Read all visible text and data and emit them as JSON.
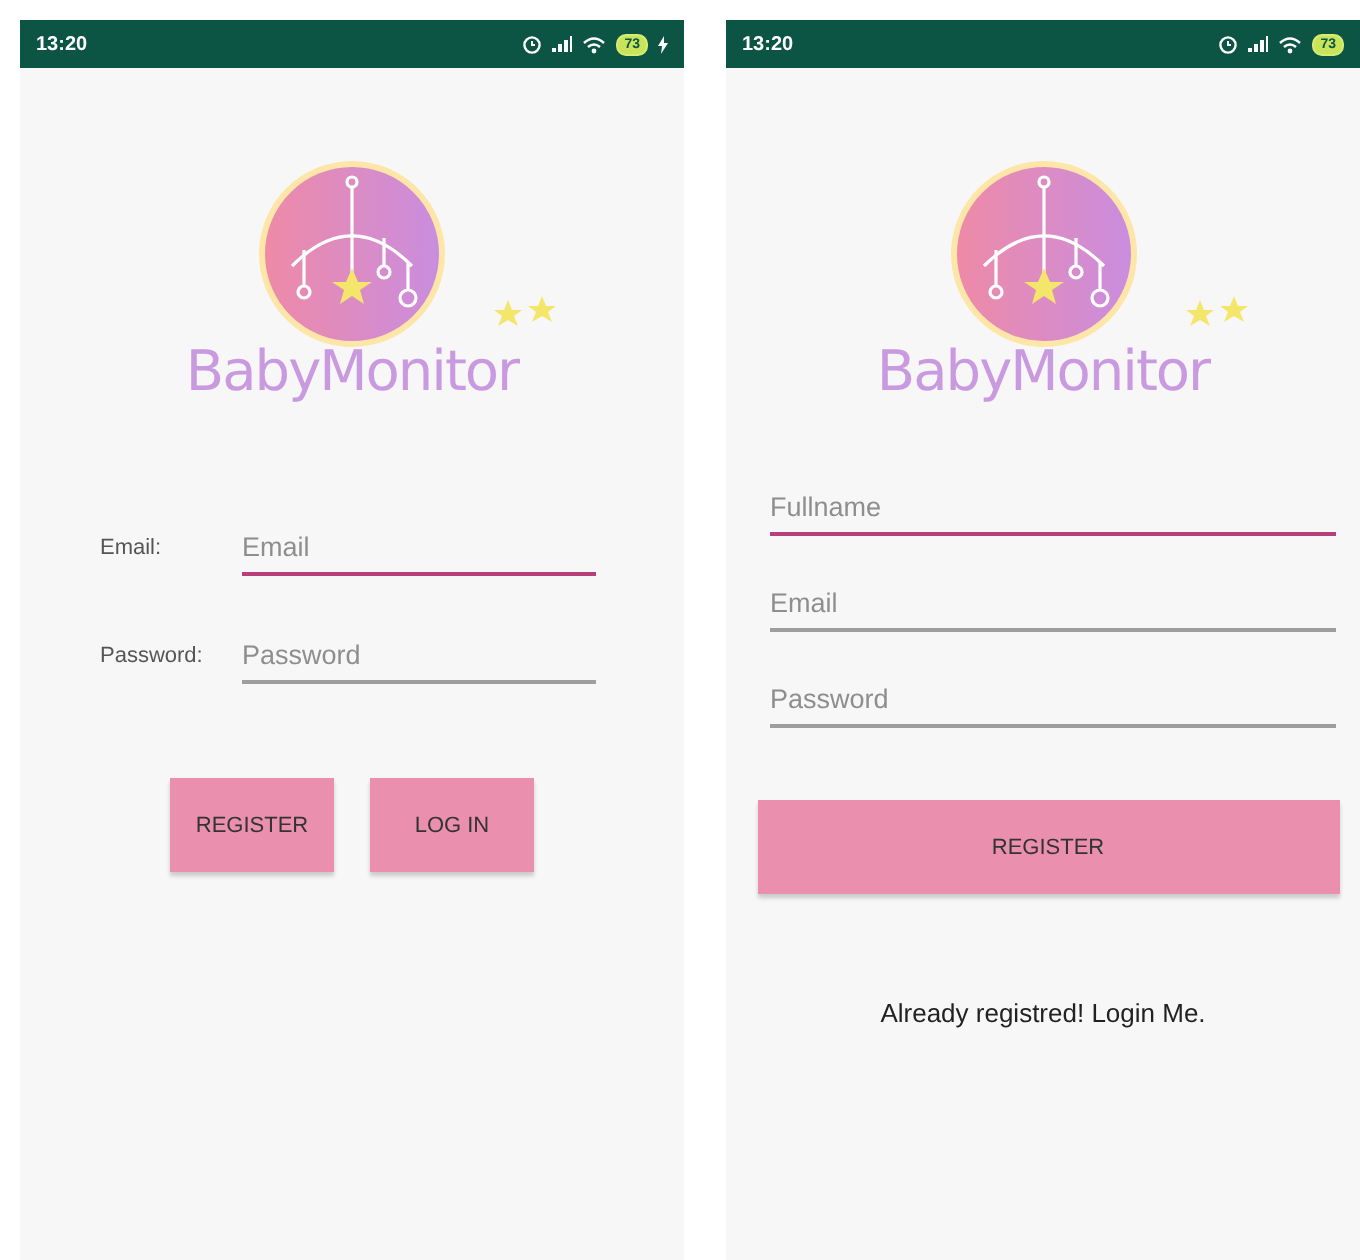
{
  "screens": [
    {
      "kind": "login",
      "status_bar": {
        "time": "13:20",
        "battery": "73",
        "charging": true
      },
      "logo": {
        "text": "BabyMonitor"
      },
      "fields": [
        {
          "label": "Email:",
          "placeholder": "Email",
          "focused": true
        },
        {
          "label": "Password:",
          "placeholder": "Password",
          "focused": false
        }
      ],
      "buttons": [
        "REGISTER",
        "LOG IN"
      ]
    },
    {
      "kind": "register",
      "status_bar": {
        "time": "13:20",
        "battery": "73",
        "charging": false
      },
      "logo": {
        "text": "BabyMonitor"
      },
      "fields": [
        {
          "placeholder": "Fullname",
          "focused": true
        },
        {
          "placeholder": "Email",
          "focused": false
        },
        {
          "placeholder": "Password",
          "focused": false
        }
      ],
      "buttons": [
        "REGISTER"
      ],
      "link": "Already registred! Login Me."
    }
  ]
}
